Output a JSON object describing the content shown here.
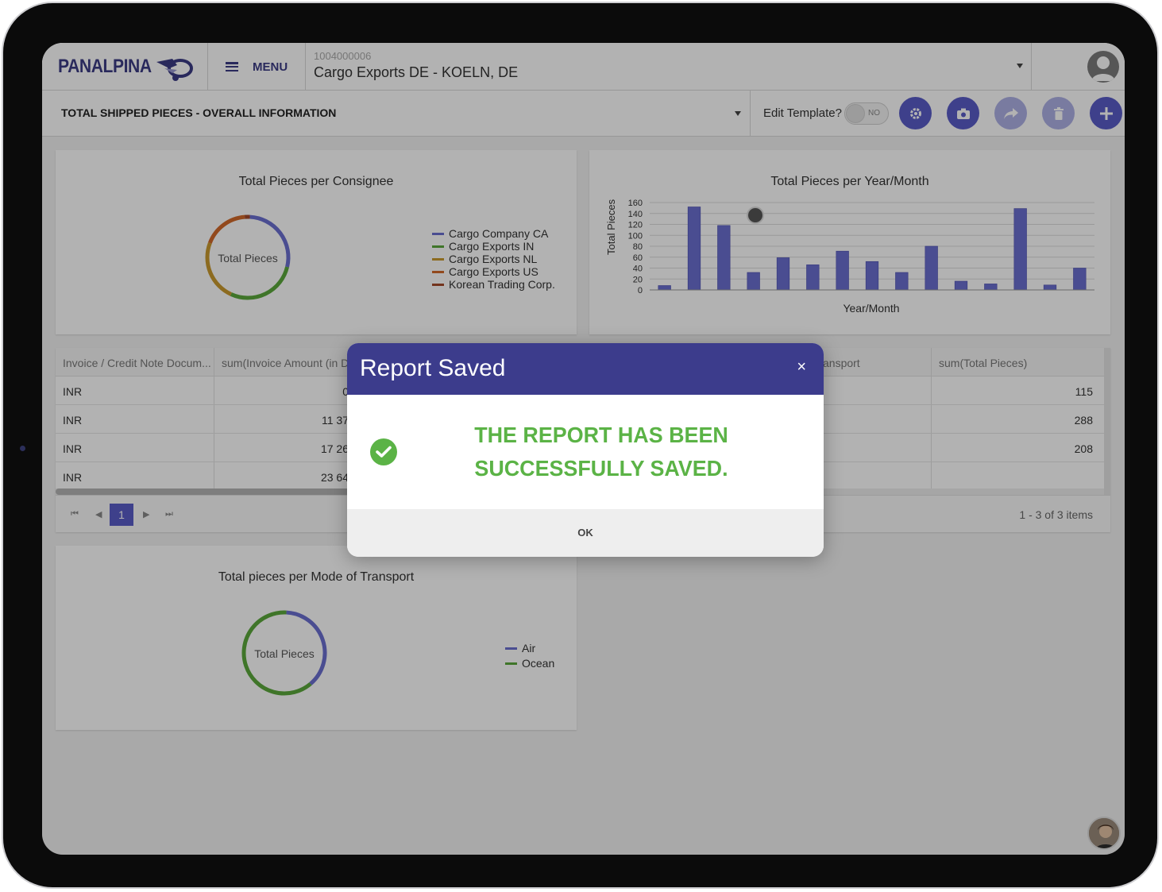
{
  "app": {
    "logo_text": "PANALPINA",
    "menu_label": "MENU",
    "account": {
      "id": "1004000006",
      "name": "Cargo Exports DE - KOELN, DE"
    }
  },
  "report": {
    "title": "TOTAL SHIPPED PIECES - OVERALL INFORMATION",
    "edit_template_label": "Edit Template?",
    "toggle_text": "NO",
    "actions": [
      "settings-icon",
      "camera-icon",
      "share-icon",
      "trash-icon",
      "plus-icon"
    ]
  },
  "colors": {
    "primary": "#5a5cc8",
    "header": "#3c3c8c",
    "success": "#5bb346"
  },
  "chart_data": [
    {
      "type": "pie",
      "title": "Total Pieces per Consignee",
      "center_label": "Total Pieces",
      "series": [
        {
          "name": "Cargo Company CA",
          "color": "#6b6fd0",
          "value": 28
        },
        {
          "name": "Cargo Exports IN",
          "color": "#5ba83c",
          "value": 28
        },
        {
          "name": "Cargo Exports NL",
          "color": "#c99a2e",
          "value": 24
        },
        {
          "name": "Cargo Exports US",
          "color": "#d2692a",
          "value": 18
        },
        {
          "name": "Korean Trading Corp.",
          "color": "#a54a2a",
          "value": 2
        }
      ]
    },
    {
      "type": "bar",
      "title": "Total Pieces per Year/Month",
      "xlabel": "Year/Month",
      "ylabel": "Total Pieces",
      "ylim": [
        0,
        160
      ],
      "yticks": [
        "160",
        "140",
        "120",
        "100",
        "80",
        "60",
        "40",
        "20",
        "0"
      ],
      "color": "#6b6fd0",
      "values": [
        8,
        152,
        118,
        32,
        59,
        46,
        71,
        52,
        32,
        80,
        16,
        11,
        149,
        9,
        40
      ]
    },
    {
      "type": "pie",
      "title": "Total pieces per Mode of Transport",
      "center_label": "Total Pieces",
      "series": [
        {
          "name": "Air",
          "color": "#6b6fd0",
          "value": 38
        },
        {
          "name": "Ocean",
          "color": "#5ba83c",
          "value": 62
        }
      ]
    }
  ],
  "grid": {
    "columns": [
      "Invoice / Credit Note Docum...",
      "sum(Invoice Amount (in D",
      "ansport",
      "sum(Total Pieces)"
    ],
    "rows": [
      {
        "currency": "INR",
        "amount": "0",
        "pieces": "115"
      },
      {
        "currency": "INR",
        "amount": "11 37",
        "pieces": "288"
      },
      {
        "currency": "INR",
        "amount": "17 26",
        "pieces": "208"
      },
      {
        "currency": "INR",
        "amount": "23 64",
        "pieces": ""
      }
    ],
    "page": "1",
    "info": "1 - 3 of 3 items"
  },
  "modal": {
    "title": "Report Saved",
    "close": "×",
    "message_line1": "THE REPORT HAS BEEN",
    "message_line2": "SUCCESSFULLY SAVED.",
    "ok_label": "OK"
  }
}
